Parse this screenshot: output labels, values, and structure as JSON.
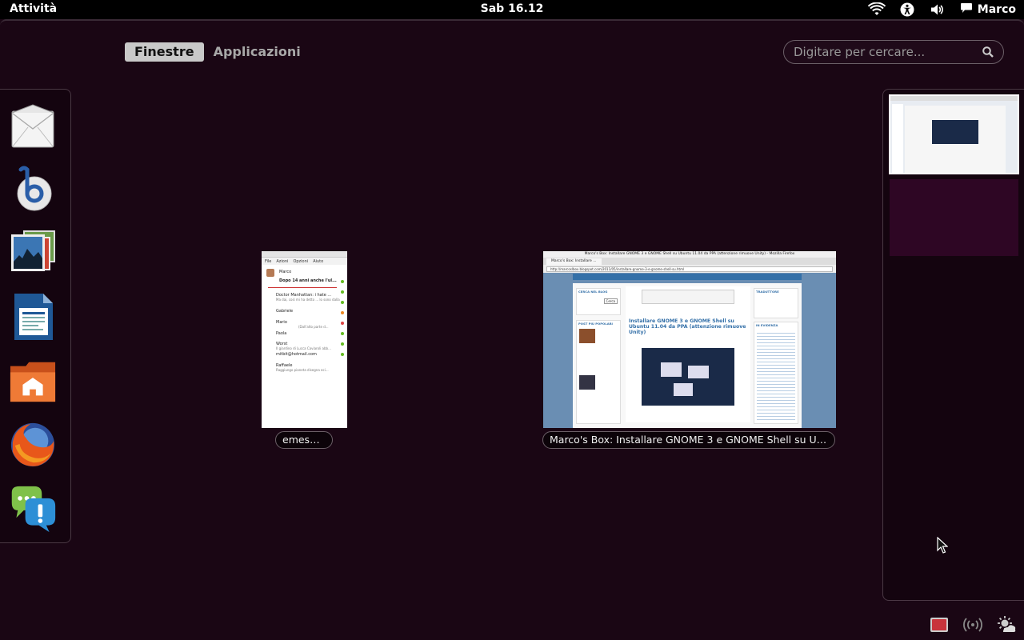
{
  "top_panel": {
    "activities_label": "Attività",
    "clock": "Sab 16.12",
    "user_name": "Marco",
    "status_icons": [
      "wifi-icon",
      "accessibility-icon",
      "volume-icon",
      "chat-status-icon"
    ]
  },
  "view_selector": {
    "tabs": [
      {
        "label": "Finestre",
        "active": true
      },
      {
        "label": "Applicazioni",
        "active": false
      }
    ]
  },
  "search": {
    "placeholder": "Digitare per cercare..."
  },
  "dash": {
    "items": [
      "mail-client-icon",
      "banshee-icon",
      "shotwell-photos-icon",
      "libreoffice-writer-icon",
      "home-folder-icon",
      "firefox-icon",
      "empathy-chat-icon"
    ]
  },
  "windows": [
    {
      "title": "emesene",
      "content": {
        "menu": [
          "File",
          "Azioni",
          "Opzioni",
          "Aiuto"
        ],
        "user": "Marco",
        "status_msg": "Dopo 14 anni anche l'ul...",
        "contacts": [
          {
            "name": "Doctor Manhattan: i hate ...",
            "sub": "Ma dai, così mi ha detto ... lo sono dalla"
          },
          {
            "name": "Gabriele",
            "sub": ""
          },
          {
            "name": "Mario",
            "sub": "(Dall'alto parte d..."
          },
          {
            "name": "Paola",
            "sub": ""
          },
          {
            "name": "Worst",
            "sub": "Il giardino di Lucca Caviaroli abb..."
          },
          {
            "name": "mitbit@hotmail.com",
            "sub": ""
          },
          {
            "name": "Raffaele",
            "sub": "Raggiungo pianeta disegna eci..."
          }
        ]
      }
    },
    {
      "title": "Marco's Box: Installare GNOME 3 e GNOME Shell su Ubu...",
      "content": {
        "window_title": "Marco's Box: Installare GNOME 3 e GNOME Shell su Ubuntu 11.04 da PPA (attenzione rimuove Unity) - Mozilla Firefox",
        "tab": "Marco's Box: Installare ...",
        "url": "http://marcoslbox.blogspot.com/2011/05/installare-gnome-3-e-gnome-shell-su.html",
        "post_title": "Installare GNOME 3 e GNOME Shell su Ubuntu 11.04 da PPA (attenzione rimuove Unity)",
        "sidebar_left": [
          "CERCA NEL BLOG",
          "POST PIÙ POPOLARI"
        ],
        "sidebar_right": [
          "TRADUTTORE",
          "IN EVIDENZA"
        ],
        "search_button": "Cerca"
      }
    }
  ],
  "workspaces": {
    "count": 2,
    "active_index": 0
  },
  "message_tray": {
    "icons": [
      "screen-recorder-icon",
      "network-icon",
      "weather-icon"
    ]
  }
}
